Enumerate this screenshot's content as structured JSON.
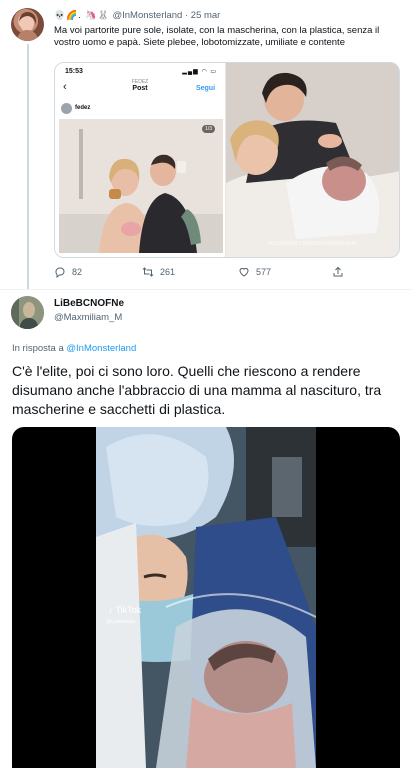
{
  "tweet1": {
    "emoji_prefix": "💀🌈. 🦄🐰",
    "handle": "@InMonsterland",
    "separator": "·",
    "date": "25 mar",
    "text": "Ma voi partorite pure sole, isolate, con la mascherina, con la plastica, senza il vostro uomo e papà. Siete plebee, lobotomizzate, umiliate e contente",
    "media": {
      "instagram": {
        "time": "15:53",
        "username_small": "FEDEZ",
        "title": "Post",
        "follow_label": "Segui",
        "user": "fedez",
        "counter": "1/3",
        "back_icon": "chevron-left-icon"
      },
      "watermark": "INSTAGRAM.COM/CHIARAFERRAGNI"
    },
    "actions": {
      "replies": "82",
      "retweets": "261",
      "likes": "577"
    }
  },
  "tweet2": {
    "name": "LiBeBCNOFNe",
    "handle": "@Maxmiliam_M",
    "reply_prefix": "In risposta a",
    "reply_target": "@InMonsterland",
    "text": "C'è l'elite, poi ci sono loro. Quelli che riescono a rendere disumano anche l'abbraccio di una mamma al nascituro, tra mascherine e sacchetti di plastica.",
    "video": {
      "platform": "TikTok",
      "id": "@cutenewbo"
    }
  },
  "colors": {
    "text": "#0f1419",
    "secondary": "#536471",
    "link": "#1d9bf0",
    "divider": "#eff3f4",
    "ig_blue": "#3897f0"
  },
  "icons": [
    "reply-icon",
    "retweet-icon",
    "like-icon",
    "share-icon",
    "chevron-left-icon",
    "tiktok-icon"
  ]
}
